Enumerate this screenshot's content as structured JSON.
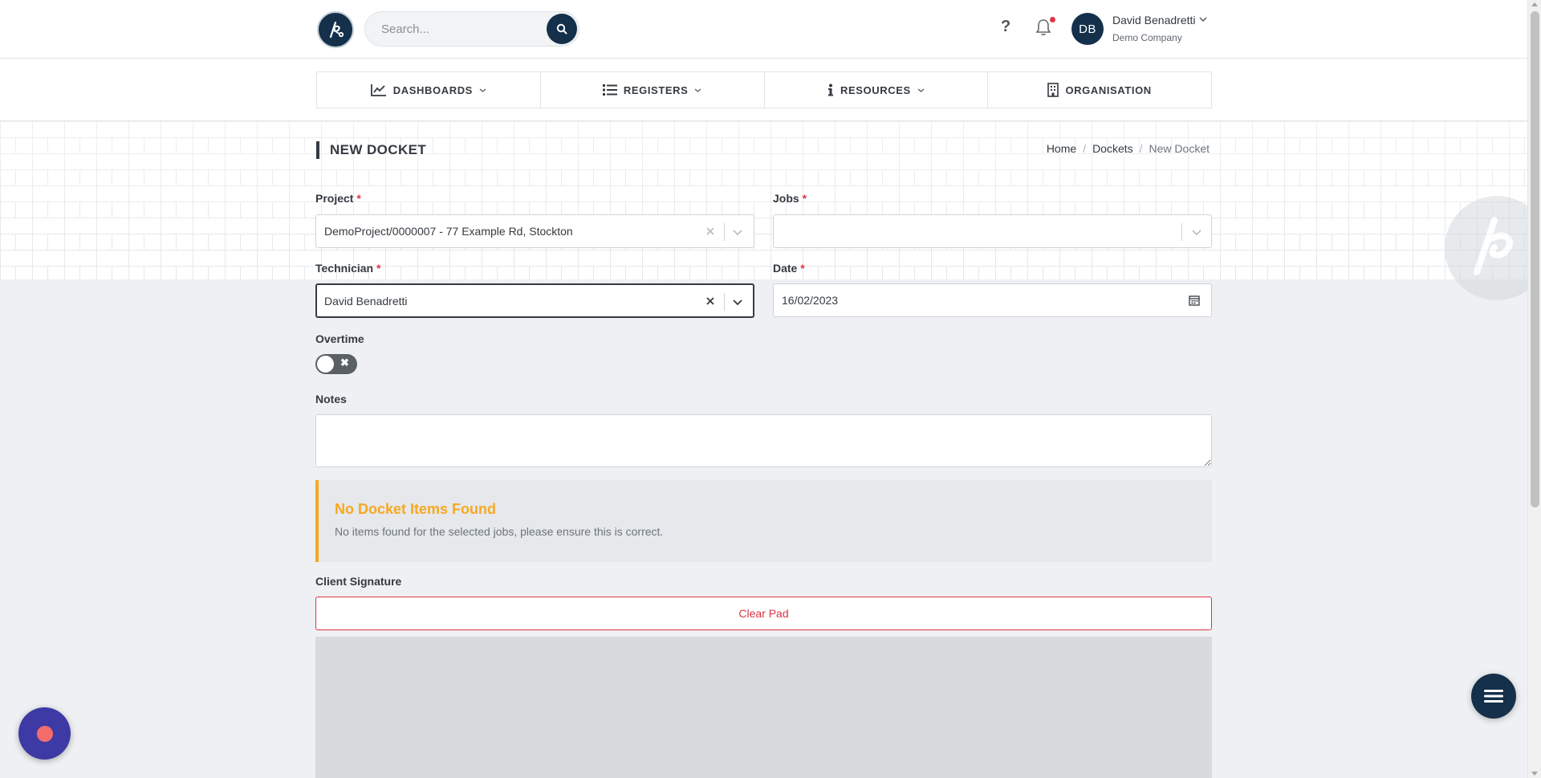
{
  "header": {
    "search_placeholder": "Search...",
    "help_label": "?",
    "user": {
      "initials": "DB",
      "name": "David Benadretti",
      "company": "Demo Company"
    }
  },
  "nav": {
    "items": [
      {
        "label": "DASHBOARDS",
        "icon": "chart-line-icon",
        "has_dropdown": true
      },
      {
        "label": "REGISTERS",
        "icon": "list-icon",
        "has_dropdown": true
      },
      {
        "label": "RESOURCES",
        "icon": "info-icon",
        "has_dropdown": true
      },
      {
        "label": "ORGANISATION",
        "icon": "building-icon",
        "has_dropdown": false
      }
    ]
  },
  "page": {
    "title": "NEW DOCKET",
    "breadcrumb": [
      "Home",
      "Dockets",
      "New Docket"
    ],
    "separator": "/"
  },
  "form": {
    "required_mark": "*",
    "project": {
      "label": "Project",
      "value": "DemoProject/0000007 - 77 Example Rd, Stockton"
    },
    "jobs": {
      "label": "Jobs",
      "value": ""
    },
    "technician": {
      "label": "Technician",
      "value": "David Benadretti"
    },
    "date": {
      "label": "Date",
      "value": "16/02/2023"
    },
    "overtime": {
      "label": "Overtime",
      "enabled": false,
      "off_symbol": "✖"
    },
    "notes": {
      "label": "Notes",
      "value": ""
    }
  },
  "alert": {
    "title": "No Docket Items Found",
    "text": "No items found for the selected jobs, please ensure this is correct."
  },
  "signature": {
    "label": "Client Signature",
    "clear_label": "Clear Pad"
  },
  "colors": {
    "brand": "#14304a",
    "required": "#dc3545",
    "warning": "#f6a821",
    "record_button": "#3d3aa5"
  }
}
